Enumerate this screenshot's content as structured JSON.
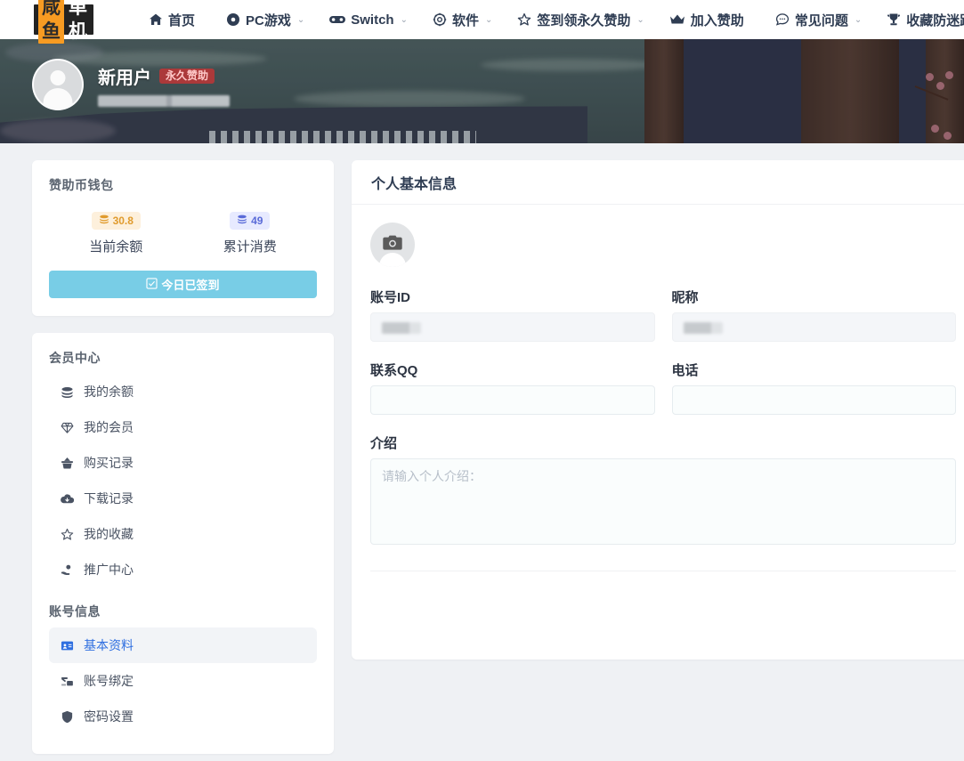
{
  "site": {
    "logo_mark": "咸鱼",
    "logo_text": "单机"
  },
  "nav": {
    "items": [
      {
        "label": "首页",
        "icon": "home-icon",
        "caret": ""
      },
      {
        "label": "PC游戏",
        "icon": "disc-icon",
        "caret": "⌄"
      },
      {
        "label": "Switch",
        "icon": "gamepad-icon",
        "caret": "⌄"
      },
      {
        "label": "软件",
        "icon": "gear-icon",
        "caret": "⌄"
      },
      {
        "label": "签到领永久赞助",
        "icon": "star-icon",
        "caret": "⌄"
      },
      {
        "label": "加入赞助",
        "icon": "crown-icon",
        "caret": ""
      },
      {
        "label": "常见问题",
        "icon": "comment-icon",
        "caret": "⌄"
      },
      {
        "label": "收藏防迷路",
        "icon": "trophy-icon",
        "caret": "⌄"
      }
    ]
  },
  "banner": {
    "username": "新用户",
    "badge": "永久赞助",
    "subtitle_redacted": true
  },
  "wallet": {
    "title": "赞助币钱包",
    "stats": [
      {
        "value": "30.8",
        "label": "当前余额",
        "color": "#e09b2d",
        "bg": "#fdf0dc"
      },
      {
        "value": "49",
        "label": "累计消费",
        "color": "#5a6bd8",
        "bg": "#e7eaff"
      }
    ],
    "signin_label": "今日已签到",
    "signin_color": "#78cde6"
  },
  "sidebar": {
    "section_member": "会员中心",
    "member_items": [
      {
        "label": "我的余额",
        "icon": "coins-icon",
        "active": false
      },
      {
        "label": "我的会员",
        "icon": "gem-icon",
        "active": false
      },
      {
        "label": "购买记录",
        "icon": "basket-icon",
        "active": false
      },
      {
        "label": "下载记录",
        "icon": "cloud-download-icon",
        "active": false
      },
      {
        "label": "我的收藏",
        "icon": "star-outline-icon",
        "active": false
      },
      {
        "label": "推广中心",
        "icon": "hand-coin-icon",
        "active": false
      }
    ],
    "section_account": "账号信息",
    "account_items": [
      {
        "label": "基本资料",
        "icon": "id-card-icon",
        "active": true
      },
      {
        "label": "账号绑定",
        "icon": "link-account-icon",
        "active": false
      },
      {
        "label": "密码设置",
        "icon": "shield-icon",
        "active": false
      }
    ],
    "active_color": "#2f6fe0"
  },
  "main": {
    "title": "个人基本信息",
    "avatar_upload_icon": "camera-icon",
    "fields": {
      "account_id": {
        "label": "账号ID",
        "value": "",
        "redacted": true,
        "disabled": true
      },
      "nickname": {
        "label": "昵称",
        "value": "",
        "redacted": true,
        "disabled": true
      },
      "qq": {
        "label": "联系QQ",
        "value": "",
        "placeholder": ""
      },
      "phone": {
        "label": "电话",
        "value": "",
        "placeholder": ""
      },
      "intro": {
        "label": "介绍",
        "value": "",
        "placeholder": "请输入个人介绍："
      }
    }
  }
}
